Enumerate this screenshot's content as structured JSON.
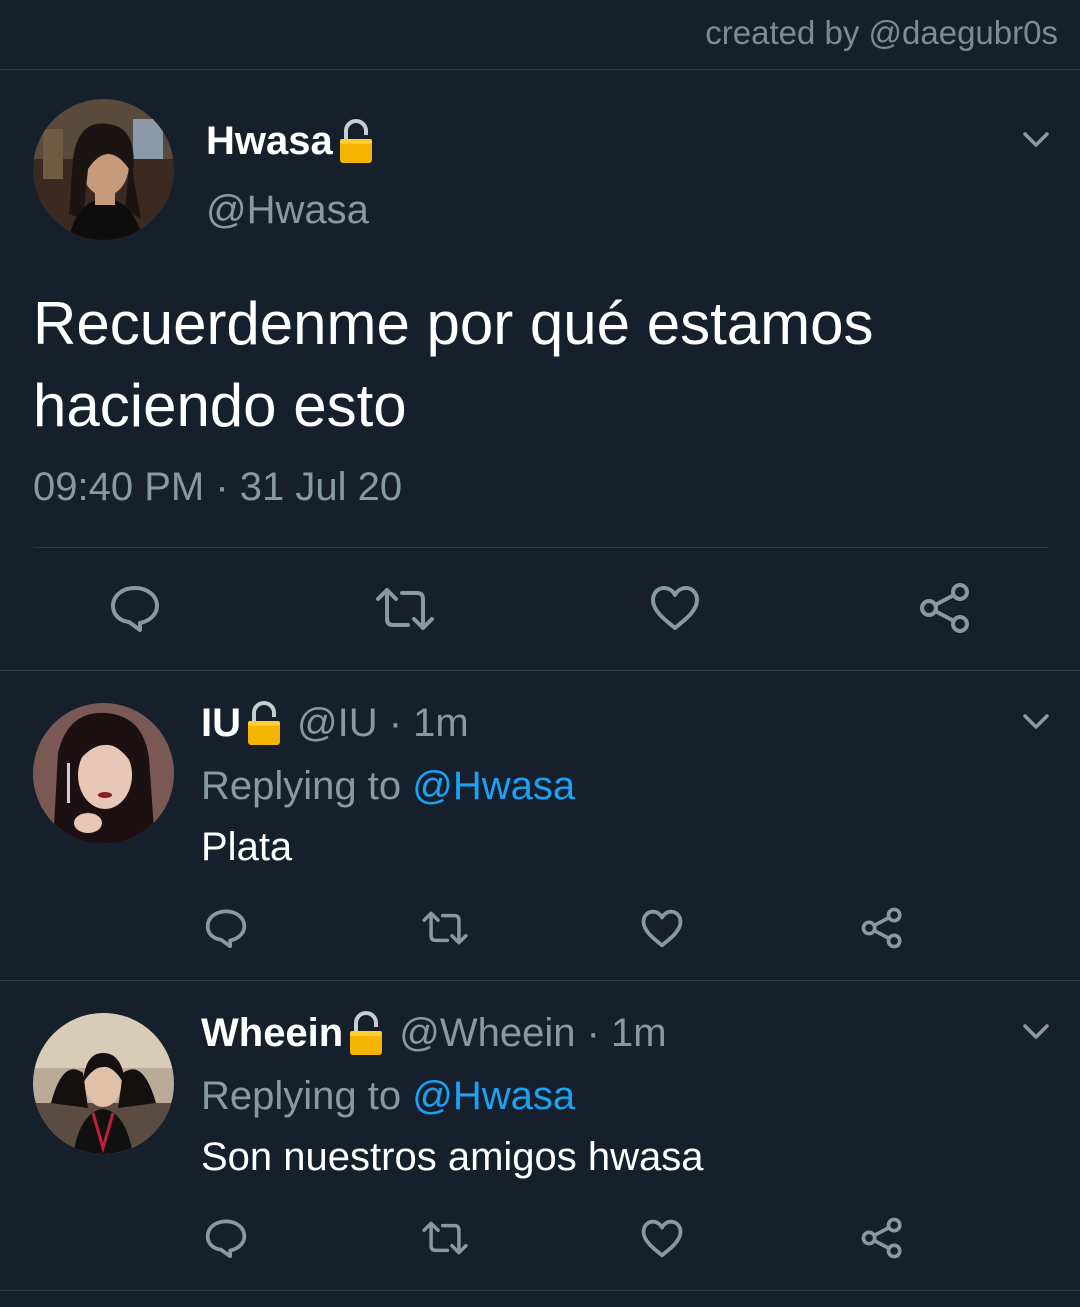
{
  "credit": "created by @daegubr0s",
  "main_tweet": {
    "name": "Hwasa",
    "handle": "@Hwasa",
    "text": "Recuerdenme por qué estamos haciendo esto",
    "timestamp": "09:40 PM · 31 Jul 20",
    "lock_icon": "lock-icon"
  },
  "replies": [
    {
      "name": "IU",
      "meta": "@IU · 1m",
      "replying_label": "Replying to",
      "replying_to": "@Hwasa",
      "text": "Plata"
    },
    {
      "name": "Wheein",
      "meta": "@Wheein · 1m",
      "replying_label": "Replying to",
      "replying_to": "@Hwasa",
      "text": "Son nuestros amigos hwasa"
    }
  ],
  "colors": {
    "background": "#16202c",
    "secondary_text": "#8899a6",
    "mention": "#1da1f2",
    "divider": "#2f3b47",
    "lock": "#f5b400"
  },
  "icons": [
    "reply-icon",
    "retweet-icon",
    "like-icon",
    "share-icon",
    "chevron-down-icon"
  ]
}
